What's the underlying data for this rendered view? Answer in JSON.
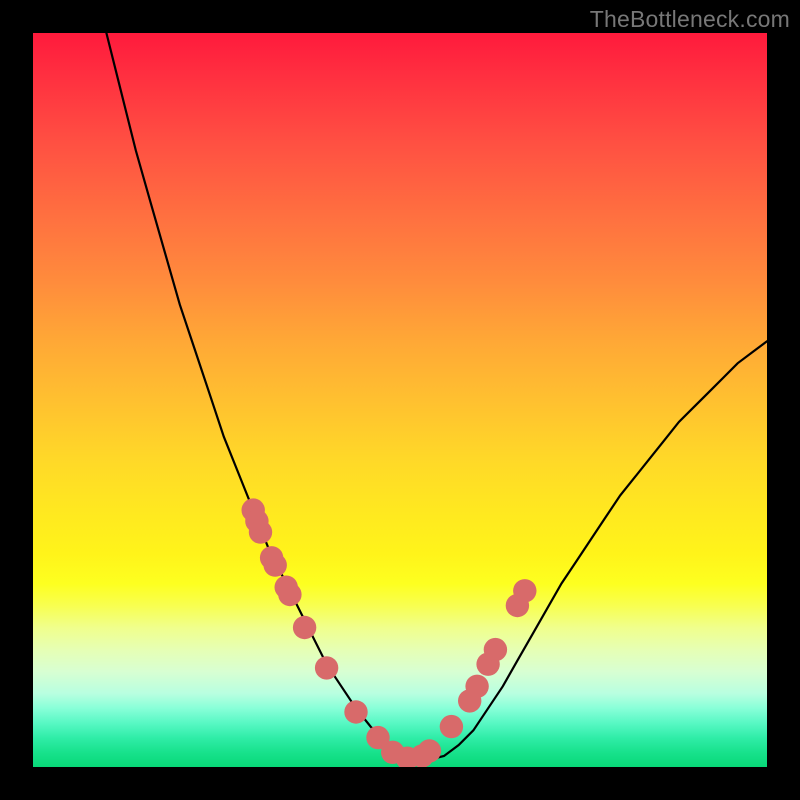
{
  "watermark": "TheBottleneck.com",
  "chart_data": {
    "type": "line",
    "title": "",
    "xlabel": "",
    "ylabel": "",
    "xlim": [
      0,
      100
    ],
    "ylim": [
      0,
      100
    ],
    "grid": false,
    "legend": false,
    "series": [
      {
        "name": "bottleneck-curve",
        "color": "#000000",
        "x": [
          10,
          12,
          14,
          16,
          18,
          20,
          22,
          24,
          26,
          28,
          30,
          32,
          34,
          36,
          38,
          40,
          42,
          44,
          46,
          48,
          50,
          52,
          54,
          56,
          58,
          60,
          62,
          64,
          66,
          68,
          70,
          72,
          74,
          76,
          78,
          80,
          82,
          84,
          86,
          88,
          90,
          92,
          94,
          96,
          98,
          100
        ],
        "y": [
          100,
          92,
          84,
          77,
          70,
          63,
          57,
          51,
          45,
          40,
          35,
          30,
          26,
          22,
          18,
          14,
          11,
          8,
          5.5,
          3.5,
          2,
          1,
          1,
          1.5,
          3,
          5,
          8,
          11,
          14.5,
          18,
          21.5,
          25,
          28,
          31,
          34,
          37,
          39.5,
          42,
          44.5,
          47,
          49,
          51,
          53,
          55,
          56.5,
          58
        ]
      }
    ],
    "markers": [
      {
        "name": "data-points",
        "color": "#d86a6a",
        "radius_pct": 1.6,
        "x": [
          30,
          30.5,
          31,
          32.5,
          33,
          34.5,
          35,
          37,
          40,
          44,
          47,
          49,
          51,
          53,
          54,
          57,
          59.5,
          60.5,
          62,
          63,
          66,
          67
        ],
        "y": [
          35,
          33.5,
          32,
          28.5,
          27.5,
          24.5,
          23.5,
          19,
          13.5,
          7.5,
          4,
          2,
          1.2,
          1.5,
          2.2,
          5.5,
          9,
          11,
          14,
          16,
          22,
          24
        ]
      }
    ],
    "gradient_stops": [
      {
        "pct": 0,
        "color": "#ff1a3c"
      },
      {
        "pct": 25,
        "color": "#ff7040"
      },
      {
        "pct": 50,
        "color": "#ffc030"
      },
      {
        "pct": 75,
        "color": "#fdff20"
      },
      {
        "pct": 90,
        "color": "#b8ffe0"
      },
      {
        "pct": 100,
        "color": "#08d878"
      }
    ]
  }
}
